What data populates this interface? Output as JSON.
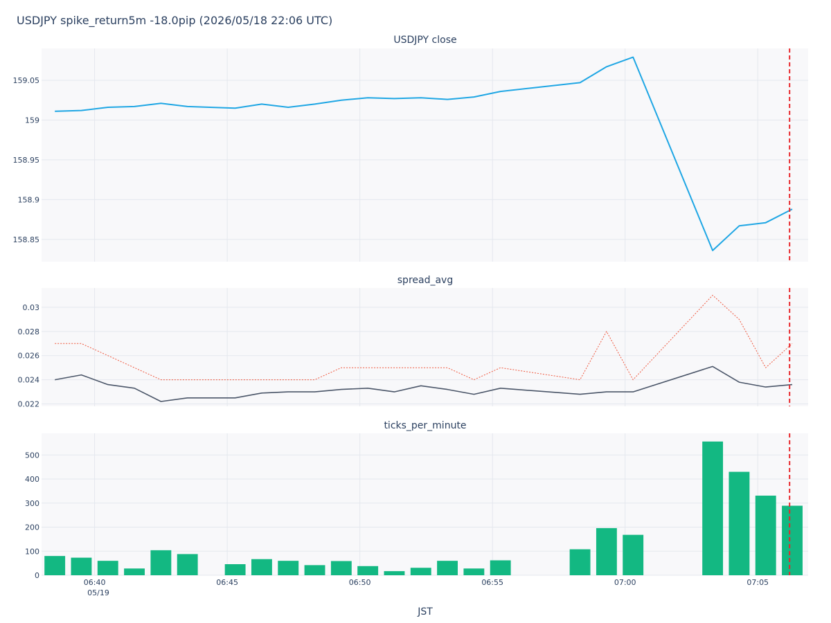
{
  "figure": {
    "title": "USDJPY spike_return5m -18.0pip (2026/05/18 22:06 UTC)",
    "x_axis_title": "JST",
    "x_date_label": "05/19",
    "event_marker_time": "07:06.2",
    "colors": {
      "plot_bg": "#f8f8fa",
      "grid": "#e4e7ee",
      "close_line": "#1ea6e4",
      "spread_line": "#4a5568",
      "spread_max_line": "#ef553b",
      "ticks_bar": "#13b882",
      "event_marker": "#e8272b"
    }
  },
  "chart_data": [
    {
      "type": "line",
      "title": "USDJPY close",
      "x_ticks": [
        "06:40",
        "06:45",
        "06:50",
        "06:55",
        "07:00",
        "07:05"
      ],
      "y_ticks": [
        "158.85",
        "158.9",
        "158.95",
        "159",
        "159.05"
      ],
      "ylim": [
        158.822,
        159.09
      ],
      "series": [
        {
          "x": [
            "06:38.5",
            "06:39.5",
            "06:40.5",
            "06:41.5",
            "06:42.5",
            "06:43.5",
            "06:45.3",
            "06:46.3",
            "06:47.3",
            "06:48.3",
            "06:49.3",
            "06:50.3",
            "06:51.3",
            "06:52.3",
            "06:53.3",
            "06:54.3",
            "06:55.3",
            "06:58.3",
            "06:59.3",
            "07:00.3",
            "07:03.3",
            "07:04.3",
            "07:05.3",
            "07:06.3"
          ],
          "y": [
            159.011,
            159.012,
            159.016,
            159.017,
            159.021,
            159.017,
            159.015,
            159.02,
            159.016,
            159.02,
            159.025,
            159.028,
            159.027,
            159.028,
            159.026,
            159.029,
            159.036,
            159.047,
            159.067,
            159.079,
            158.836,
            158.867,
            158.871,
            158.888
          ]
        }
      ]
    },
    {
      "type": "line",
      "title": "spread_avg",
      "x_ticks": [
        "06:40",
        "06:45",
        "06:50",
        "06:55",
        "07:00",
        "07:05"
      ],
      "y_ticks": [
        "0.022",
        "0.024",
        "0.026",
        "0.028",
        "0.03"
      ],
      "ylim": [
        0.0218,
        0.0316
      ],
      "series": [
        {
          "style": "solid",
          "x": [
            "06:38.5",
            "06:39.5",
            "06:40.5",
            "06:41.5",
            "06:42.5",
            "06:43.5",
            "06:45.3",
            "06:46.3",
            "06:47.3",
            "06:48.3",
            "06:49.3",
            "06:50.3",
            "06:51.3",
            "06:52.3",
            "06:53.3",
            "06:54.3",
            "06:55.3",
            "06:58.3",
            "06:59.3",
            "07:00.3",
            "07:03.3",
            "07:04.3",
            "07:05.3",
            "07:06.3"
          ],
          "y": [
            0.024,
            0.0244,
            0.0236,
            0.0233,
            0.0222,
            0.0225,
            0.0225,
            0.0229,
            0.023,
            0.023,
            0.0232,
            0.0233,
            0.023,
            0.0235,
            0.0232,
            0.0228,
            0.0233,
            0.0228,
            0.023,
            0.023,
            0.0251,
            0.0238,
            0.0234,
            0.0236
          ]
        },
        {
          "style": "dotted",
          "x": [
            "06:38.5",
            "06:39.5",
            "06:40.5",
            "06:41.5",
            "06:42.5",
            "06:43.5",
            "06:45.3",
            "06:46.3",
            "06:47.3",
            "06:48.3",
            "06:49.3",
            "06:50.3",
            "06:51.3",
            "06:52.3",
            "06:53.3",
            "06:54.3",
            "06:55.3",
            "06:58.3",
            "06:59.3",
            "07:00.3",
            "07:03.3",
            "07:04.3",
            "07:05.3",
            "07:06.3"
          ],
          "y": [
            0.027,
            0.027,
            0.026,
            0.025,
            0.024,
            0.024,
            0.024,
            0.024,
            0.024,
            0.024,
            0.025,
            0.025,
            0.025,
            0.025,
            0.025,
            0.024,
            0.025,
            0.024,
            0.028,
            0.024,
            0.031,
            0.029,
            0.025,
            0.027
          ]
        }
      ]
    },
    {
      "type": "bar",
      "title": "ticks_per_minute",
      "x_ticks": [
        "06:40",
        "06:45",
        "06:50",
        "06:55",
        "07:00",
        "07:05"
      ],
      "y_ticks": [
        "0",
        "100",
        "200",
        "300",
        "400",
        "500"
      ],
      "ylim": [
        0,
        590
      ],
      "series": [
        {
          "x": [
            "06:38.5",
            "06:39.5",
            "06:40.5",
            "06:41.5",
            "06:42.5",
            "06:43.5",
            "06:45.3",
            "06:46.3",
            "06:47.3",
            "06:48.3",
            "06:49.3",
            "06:50.3",
            "06:51.3",
            "06:52.3",
            "06:53.3",
            "06:54.3",
            "06:55.3",
            "06:58.3",
            "06:59.3",
            "07:00.3",
            "07:03.3",
            "07:04.3",
            "07:05.3",
            "07:06.3"
          ],
          "y": [
            80,
            73,
            60,
            28,
            104,
            88,
            46,
            67,
            60,
            42,
            59,
            38,
            17,
            31,
            60,
            28,
            62,
            108,
            196,
            168,
            556,
            430,
            331,
            289
          ]
        }
      ]
    }
  ]
}
